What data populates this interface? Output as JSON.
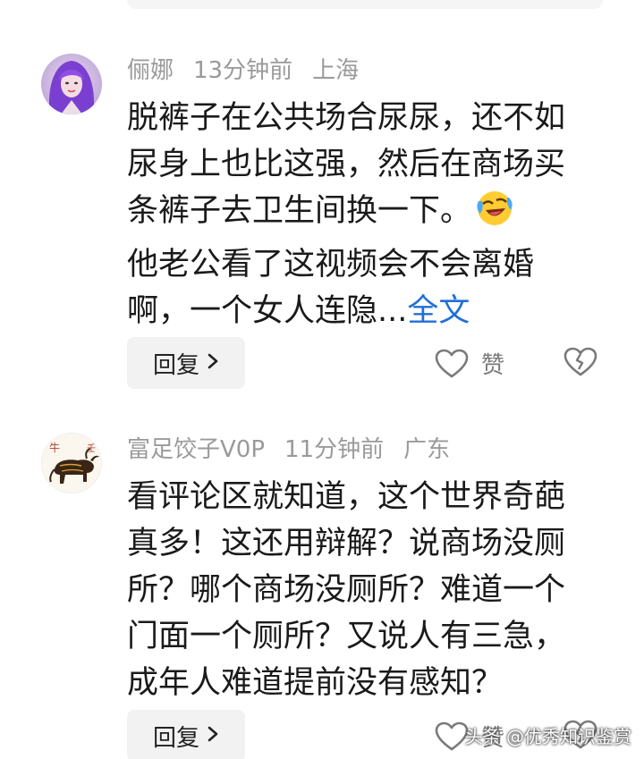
{
  "comments": [
    {
      "username": "俪娜",
      "time": "13分钟前",
      "location": "上海",
      "lines": [
        "脱裤子在公共场合尿尿，还不如",
        "尿身上也比这强，然后在商场买",
        "条裤子去卫生间换一下。",
        "他老公看了这视频会不会离婚",
        "啊，一个女人连隐..."
      ],
      "more_label": "全文",
      "emoji": "laughing-crying-emoji",
      "reply_label": "回复",
      "like_label": "赞"
    },
    {
      "username": "富足饺子V0P",
      "time": "11分钟前",
      "location": "广东",
      "lines": [
        "看评论区就知道，这个世界奇葩",
        "真多！这还用辩解？说商场没厕",
        "所？哪个商场没厕所？难道一个",
        "门面一个厕所？又说人有三急，",
        "成年人难道提前没有感知？"
      ],
      "reply_label": "回复",
      "like_label": "赞"
    }
  ],
  "watermark": "头条 @优秀知识鉴赏",
  "icons": {
    "like": "heart-icon",
    "dislike": "broken-heart-icon",
    "reply_chevron": "chevron-right-icon"
  },
  "colors": {
    "link": "#1f6fd6",
    "meta": "#9a9a9a",
    "text": "#1a1a1a",
    "button_bg": "#f2f2f2"
  }
}
